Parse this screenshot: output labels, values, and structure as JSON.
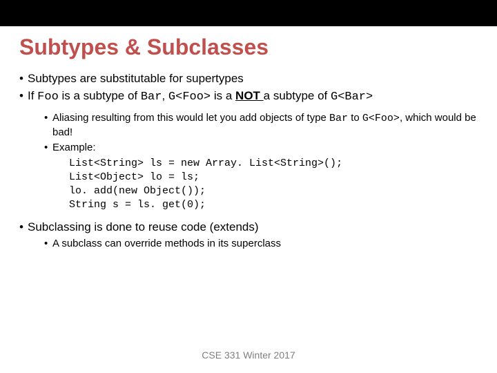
{
  "title": "Subtypes & Subclasses",
  "bullets": {
    "l1": "Subtypes are substitutable for supertypes",
    "l2a": "If ",
    "l2b": "Foo",
    "l2c": " is a subtype of ",
    "l2d": "Bar",
    "l2e": ", ",
    "l2f": "G<Foo>",
    "l2g": " is a ",
    "l2h": "NOT ",
    "l2i": "a subtype of ",
    "l2j": "G<Bar>",
    "s1a": "Aliasing resulting from this would let you add objects of type ",
    "s1b": "Bar",
    "s1c": " to ",
    "s1d": "G<Foo>",
    "s1e": ", which would be bad!",
    "s2": "Example:",
    "code1": "List<String> ls = new Array. List<String>();",
    "code2": "List<Object> lo = ls;",
    "code3": "lo. add(new Object());",
    "code4": "String s = ls. get(0);",
    "l3": "Subclassing is done to reuse code (extends)",
    "s3": "A subclass can override methods in its superclass"
  },
  "footer": "CSE 331 Winter 2017"
}
